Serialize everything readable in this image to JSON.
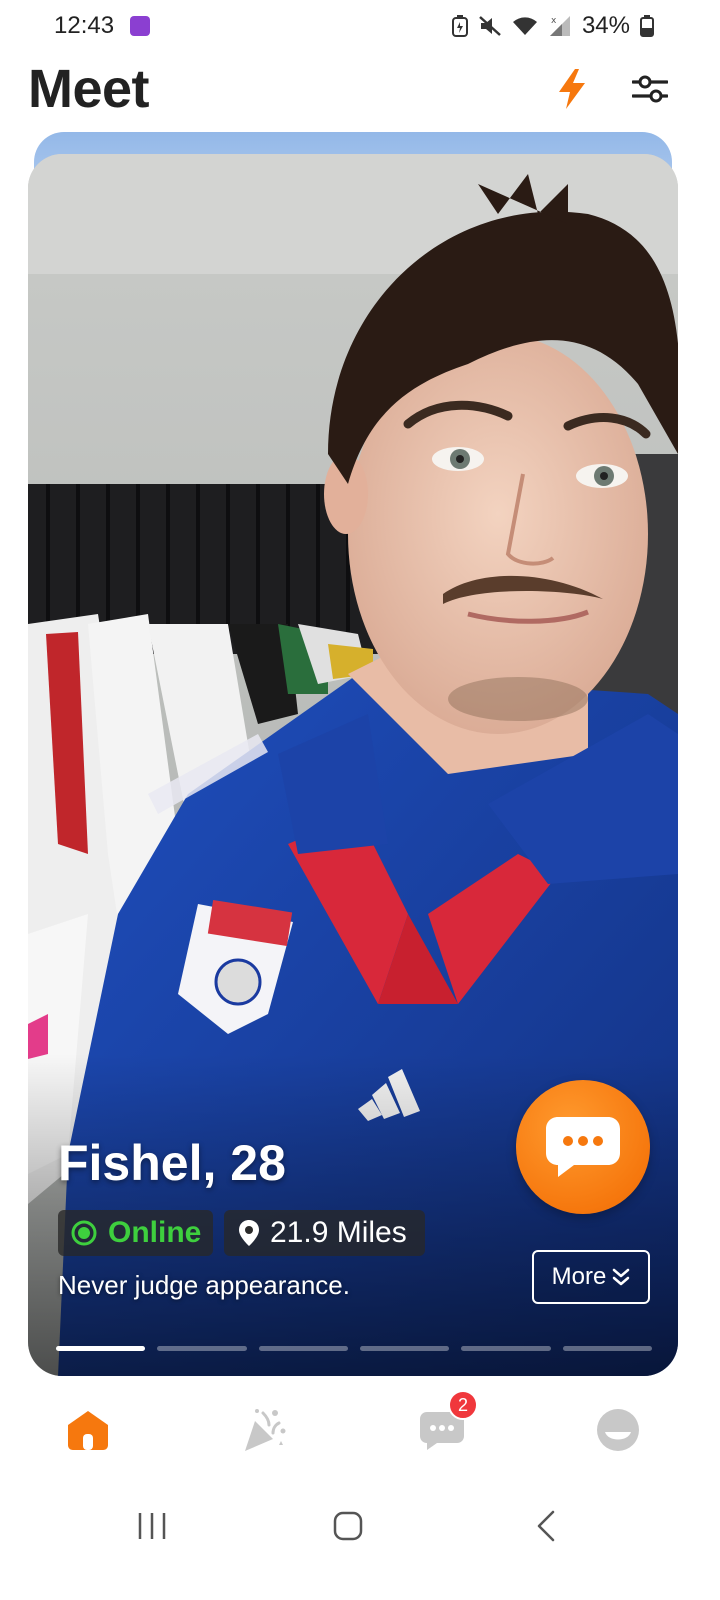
{
  "status_bar": {
    "time": "12:43",
    "battery": "34%",
    "icons": [
      "app-notification-icon",
      "battery-saver-icon",
      "mute-icon",
      "wifi-icon",
      "signal-icon",
      "battery-icon"
    ]
  },
  "header": {
    "title": "Meet",
    "boost_icon": "lightning-icon",
    "filter_icon": "sliders-icon"
  },
  "profile_card": {
    "name_age": "Fishel, 28",
    "status": "Online",
    "distance": "21.9 Miles",
    "bio": "Never judge appearance.",
    "more_label": "More",
    "photo_count": 6,
    "active_photo": 1
  },
  "bottom_nav": {
    "items": [
      {
        "name": "home",
        "icon": "home-icon",
        "active": true
      },
      {
        "name": "party",
        "icon": "party-popper-icon",
        "active": false
      },
      {
        "name": "messages",
        "icon": "chat-icon",
        "active": false,
        "badge": "2"
      },
      {
        "name": "profile",
        "icon": "avatar-icon",
        "active": false
      }
    ]
  },
  "colors": {
    "accent": "#F6780E",
    "online": "#3ECF3E",
    "badge": "#F0373C",
    "nav_inactive": "#C8C8C8"
  }
}
